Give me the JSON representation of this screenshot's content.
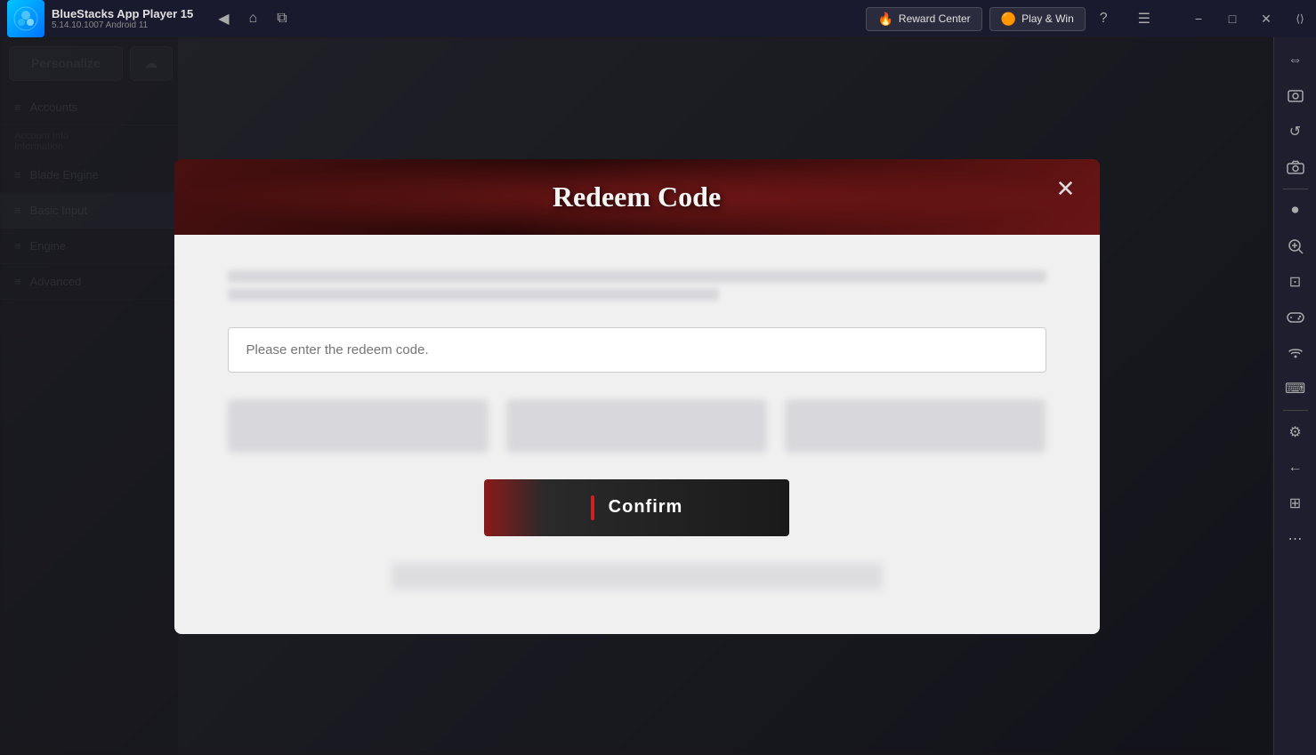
{
  "titleBar": {
    "appName": "BlueStacks App Player 15",
    "version": "5.14.10.1007  Android 11",
    "rewardCenter": "Reward Center",
    "playAndWin": "Play & Win",
    "navBack": "←",
    "navHome": "⌂",
    "navLayers": "⧉",
    "helpIcon": "?",
    "menuIcon": "☰",
    "minimizeIcon": "−",
    "maximizeIcon": "□",
    "closeIcon": "✕",
    "expandIcon": "⟨⟩"
  },
  "modal": {
    "title": "Redeem Code",
    "closeIcon": "✕",
    "inputPlaceholder": "Please enter the redeem code.",
    "confirmLabel": "Confirm"
  },
  "sidebar": {
    "icons": [
      {
        "name": "expand-arrows",
        "glyph": "⇔"
      },
      {
        "name": "screenshot",
        "glyph": "⬜"
      },
      {
        "name": "refresh",
        "glyph": "↺"
      },
      {
        "name": "camera",
        "glyph": "📷"
      },
      {
        "name": "record",
        "glyph": "⏺"
      },
      {
        "name": "zoom-in",
        "glyph": "⊕"
      },
      {
        "name": "zoom-out",
        "glyph": "⊖"
      },
      {
        "name": "gamepad",
        "glyph": "🎮"
      },
      {
        "name": "wifi",
        "glyph": "📶"
      },
      {
        "name": "keyboard",
        "glyph": "⌨"
      },
      {
        "name": "settings",
        "glyph": "⚙"
      },
      {
        "name": "arrow-left",
        "glyph": "←"
      },
      {
        "name": "grid",
        "glyph": "⊞"
      },
      {
        "name": "more",
        "glyph": "⋯"
      }
    ]
  },
  "leftPanel": {
    "items": [
      {
        "label": "Personalize",
        "icon": "◀"
      },
      {
        "label": "",
        "icon": "☁"
      },
      {
        "label": "Accounts",
        "icon": "≡"
      },
      {
        "label": "Account Info",
        "sublabel": "Information"
      },
      {
        "label": "Blade Engine",
        "icon": "≡"
      },
      {
        "label": "Basic Input",
        "icon": "≡"
      },
      {
        "label": "Engine",
        "icon": "≡"
      },
      {
        "label": "Advanced",
        "icon": "≡"
      }
    ]
  },
  "colors": {
    "titleBarBg": "#1a1a2e",
    "sidebarBg": "#1e1e2e",
    "modalHeaderBg": "#5a1a1a",
    "modalBodyBg": "#f0f0f0",
    "confirmBtnBg": "#1a1a1a",
    "confirmBtnAccent": "#cc2222",
    "overlayColor": "rgba(0,0,0,0.55)"
  }
}
